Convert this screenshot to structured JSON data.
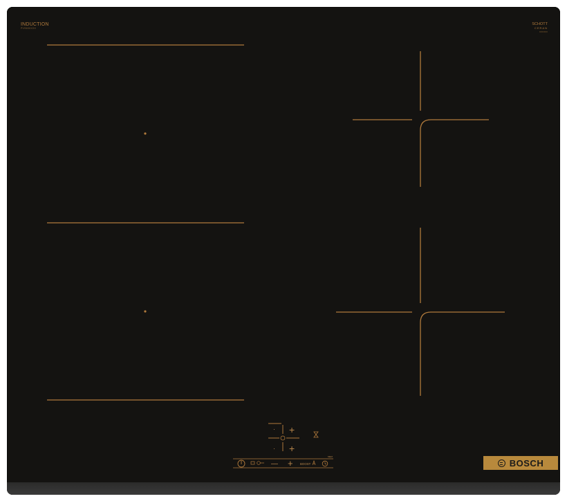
{
  "product": {
    "type_label": "INDUCTION",
    "model_code": "PVS63XXXX",
    "glass_brand_line1": "SCHOTT",
    "glass_brand_line2": "CERAN",
    "glass_small_text": "XXXXXXX",
    "brand": "BOSCH"
  },
  "controls": {
    "timer_minus_top": "·",
    "timer_minus_bottom": "·",
    "plus_label": "+",
    "minus_label": "—",
    "power_icon": "power-icon",
    "lock_icon": "lock-icon",
    "boost_label": "BOOST",
    "timer_icon": "timer-icon",
    "wipe_icon": "hourglass-icon",
    "small_label": "MEM"
  },
  "colors": {
    "glass": "#141311",
    "accent": "#b07a3c",
    "badge": "#b8893c"
  }
}
